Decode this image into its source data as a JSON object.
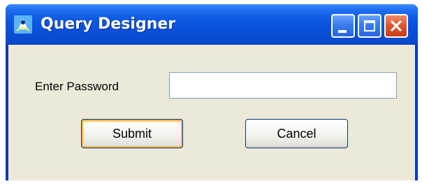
{
  "window": {
    "title": "Query Designer",
    "app_icon": "query-designer-app-icon",
    "controls": {
      "minimize_icon": "minimize-icon",
      "maximize_icon": "maximize-icon",
      "close_icon": "close-icon"
    }
  },
  "form": {
    "password_label": "Enter Password",
    "password_value": "",
    "submit_label": "Submit",
    "cancel_label": "Cancel"
  },
  "colors": {
    "titlebar_blue": "#0a50da",
    "close_red": "#e0532c",
    "dialog_face": "#ece9d8",
    "focus_orange": "#f8b350"
  }
}
